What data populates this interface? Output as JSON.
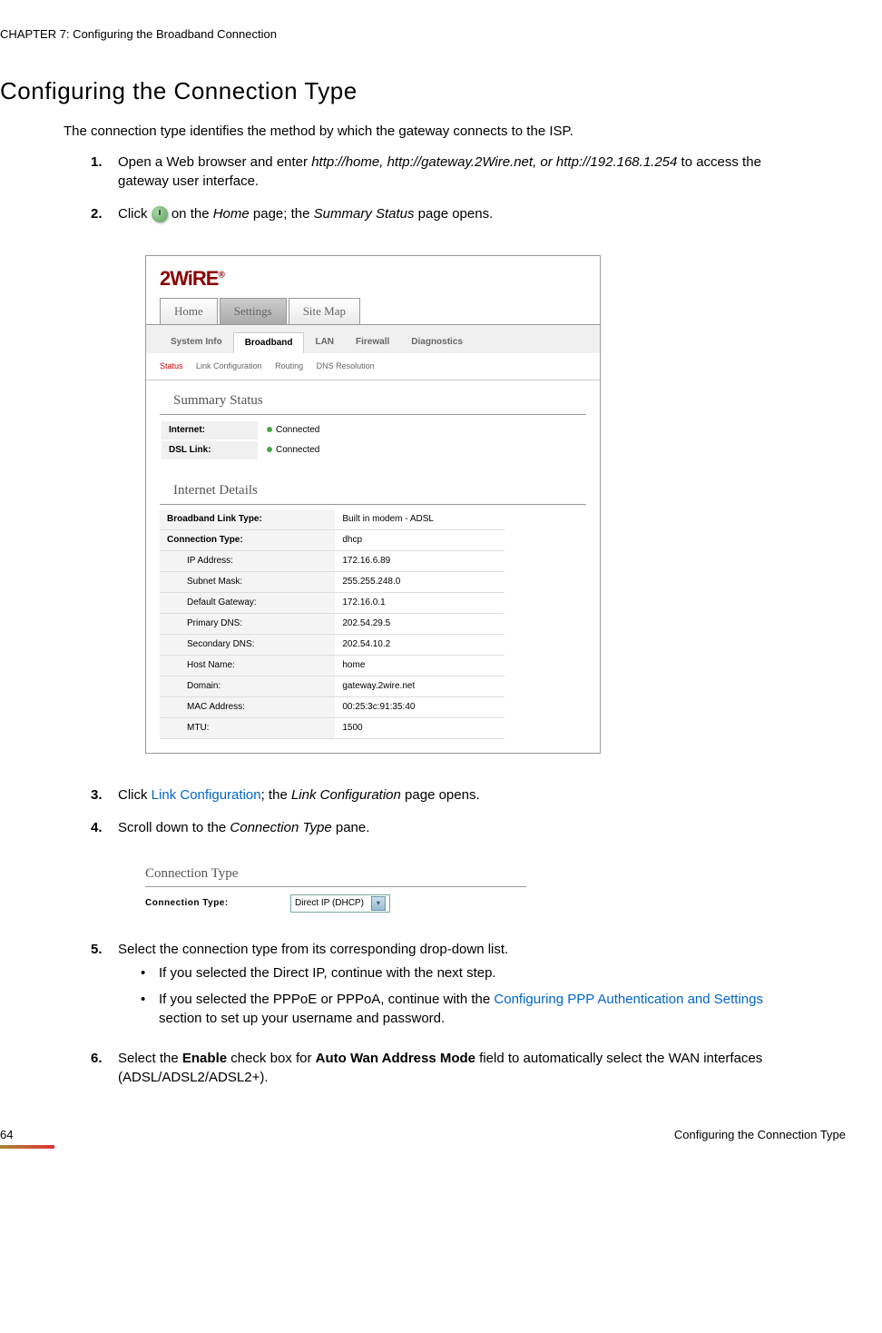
{
  "chapter_header": "CHAPTER 7: Configuring the Broadband Connection",
  "section_title": "Configuring the Connection Type",
  "intro": "The connection type identifies the method by which the gateway connects to the ISP.",
  "steps": {
    "s1_num": "1.",
    "s1_a": "Open a Web browser and enter ",
    "s1_b": "http://home, http://gateway.2Wire.net, or http://192.168.1.254",
    "s1_c": " to access the gateway user interface.",
    "s2_num": "2.",
    "s2_a": "Click ",
    "s2_b": " on the ",
    "s2_c": "Home",
    "s2_d": " page; the ",
    "s2_e": "Summary Status",
    "s2_f": " page opens.",
    "s3_num": "3.",
    "s3_a": "Click ",
    "s3_link": "Link Configuration",
    "s3_b": "; the ",
    "s3_c": "Link Configuration",
    "s3_d": " page opens.",
    "s4_num": "4.",
    "s4_a": "Scroll down to the ",
    "s4_b": "Connection Type",
    "s4_c": " pane.",
    "s5_num": "5.",
    "s5_a": "Select the connection type from its corresponding drop-down list.",
    "s5_b1": "If you selected the Direct IP, continue with the next step.",
    "s5_b2a": "If you selected the PPPoE or PPPoA, continue with the ",
    "s5_b2link": "Configuring PPP Authentication and Settings",
    "s5_b2b": " section to set up your username and password.",
    "s6_num": "6.",
    "s6_a": "Select the ",
    "s6_b": "Enable",
    "s6_c": " check box for ",
    "s6_d": "Auto Wan Address Mode",
    "s6_e": " field to automatically select the WAN interfaces (ADSL/ADSL2/ADSL2+)."
  },
  "ui": {
    "logo": "2WiRE",
    "logo_reg": "®",
    "tabs": {
      "home": "Home",
      "settings": "Settings",
      "sitemap": "Site Map"
    },
    "subtabs": {
      "system": "System Info",
      "broadband": "Broadband",
      "lan": "LAN",
      "firewall": "Firewall",
      "diag": "Diagnostics"
    },
    "subsub": {
      "status": "Status",
      "linkconf": "Link Configuration",
      "routing": "Routing",
      "dns": "DNS Resolution"
    },
    "summary_h": "Summary Status",
    "internet_l": "Internet:",
    "internet_v": "Connected",
    "dsl_l": "DSL Link:",
    "dsl_v": "Connected",
    "details_h": "Internet Details",
    "blt_l": "Broadband Link Type:",
    "blt_v": "Built in modem - ADSL",
    "ct_l": "Connection Type:",
    "ct_v": "dhcp",
    "ip_l": "IP Address:",
    "ip_v": "172.16.6.89",
    "sm_l": "Subnet Mask:",
    "sm_v": "255.255.248.0",
    "dg_l": "Default Gateway:",
    "dg_v": "172.16.0.1",
    "pdns_l": "Primary DNS:",
    "pdns_v": "202.54.29.5",
    "sdns_l": "Secondary DNS:",
    "sdns_v": "202.54.10.2",
    "hn_l": "Host Name:",
    "hn_v": "home",
    "dom_l": "Domain:",
    "dom_v": "gateway.2wire.net",
    "mac_l": "MAC Address:",
    "mac_v": "00:25:3c:91:35:40",
    "mtu_l": "MTU:",
    "mtu_v": "1500"
  },
  "conn_pane": {
    "header": "Connection Type",
    "label": "Connection Type:",
    "value": "Direct IP (DHCP)"
  },
  "footer": {
    "page": "64",
    "title": "Configuring the Connection Type"
  }
}
